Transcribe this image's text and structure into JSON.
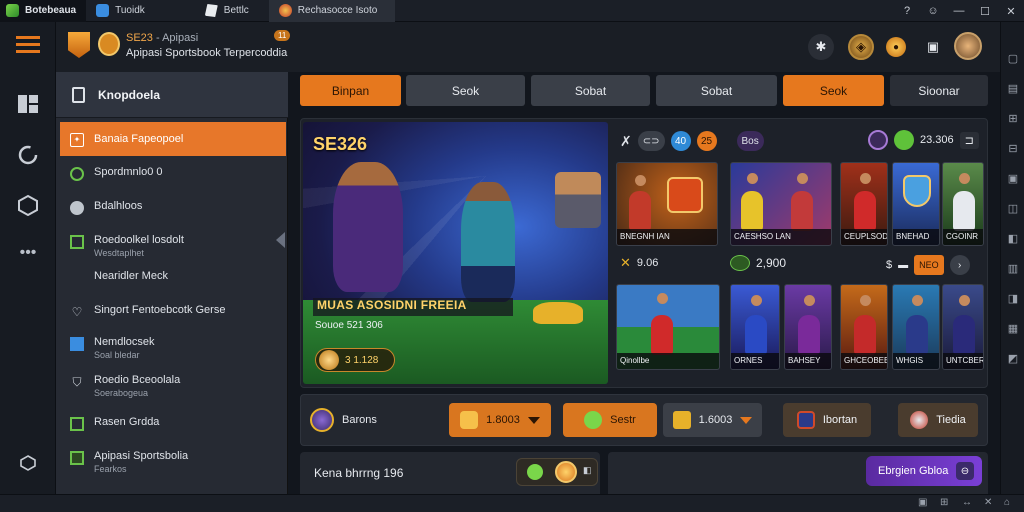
{
  "titlebar": {
    "app_name": "Botebeaua",
    "tabs": [
      {
        "label": "Tuoidk",
        "icon": "window-icon"
      },
      {
        "label": "Bettlc",
        "icon": "bag-icon"
      },
      {
        "label": "Rechasocce Isoto",
        "icon": "globe-icon"
      }
    ],
    "controls": [
      "help-icon",
      "smile-icon",
      "minimize-icon",
      "maximize-icon",
      "close-icon"
    ]
  },
  "header": {
    "brand_name": "SE23",
    "brand_sep": " - Apipasi",
    "brand_line2": "Apipasi Sportsbook Terpercoddia",
    "badge": "11"
  },
  "sidebar": {
    "title": "Knopdoela",
    "items": [
      {
        "label": "Banaia Fapeopoel",
        "sub": "",
        "icon": "gift-icon",
        "active": true
      },
      {
        "label": "Spordmnlo0 0",
        "sub": "",
        "icon": "circle-icon"
      },
      {
        "label": "Bdalhloos",
        "sub": "",
        "icon": "ball-icon"
      },
      {
        "label": "Roedoolkel losdolt",
        "sub": "Wesdtaplhet",
        "icon": "grid-icon"
      },
      {
        "label": "Nearidler Meck",
        "sub": "",
        "icon": ""
      },
      {
        "label": "Singort Fentoebcotk Gerse",
        "sub": "",
        "icon": "heart-icon"
      },
      {
        "label": "Nemdlocsek",
        "sub": "Soal bledar",
        "icon": "square-icon"
      },
      {
        "label": "Roedio Bceoolala",
        "sub": "Soerabogeua",
        "icon": "shield-icon"
      },
      {
        "label": "Rasen Grdda",
        "sub": "",
        "icon": "square-outline-icon"
      },
      {
        "label": "Apipasi Sportsbolia",
        "sub": "Fearkos",
        "icon": "box-icon"
      }
    ]
  },
  "tabs": [
    {
      "label": "Binpan",
      "style": "orange"
    },
    {
      "label": "Seok",
      "style": "grey"
    },
    {
      "label": "Sobat",
      "style": "grey"
    },
    {
      "label": "Sobat",
      "style": "grey"
    },
    {
      "label": "Seok",
      "style": "orange"
    },
    {
      "label": "Sioonar",
      "style": "pale"
    }
  ],
  "hero": {
    "title": "SE326",
    "banner": "MUAS ASOSIDNI FREEIA",
    "subline": "Souoe 521 306",
    "coin_value": "3 1.128"
  },
  "market_header": {
    "pill_1": "40",
    "pill_2": "25",
    "label": "Bos",
    "score": "23.306"
  },
  "cards_row1": [
    {
      "caption": "BNEGNH IAN",
      "bg": "#4a2a16"
    },
    {
      "caption": "CAESHSO LAN",
      "bg": "#1c2a6a"
    },
    {
      "caption": "CEUPLSOD",
      "bg": "#5a1a10"
    },
    {
      "caption": "BNEHAD",
      "bg": "#1a3a6a"
    },
    {
      "caption": "CGOINR",
      "bg": "#2a4a2a"
    }
  ],
  "meta": {
    "left_value": "9.06",
    "mid_value": "2,900",
    "right_badge": "NEO"
  },
  "cards_row2": [
    {
      "caption": "Qinollbe",
      "bg": "#1b4a2c"
    },
    {
      "caption": "ORNES",
      "bg": "#1b2b6a"
    },
    {
      "caption": "BAHSEY",
      "bg": "#3a1b5a"
    },
    {
      "caption": "GHCEOBEE",
      "bg": "#6a2a10"
    },
    {
      "caption": "WHGIS",
      "bg": "#1a4a5a"
    },
    {
      "caption": "UNTCBER",
      "bg": "#2a2a5a"
    }
  ],
  "bottom_bar": {
    "left_label": "Barons",
    "btn_1": "1.8003",
    "btn_2": "Sestr",
    "btn_3": "1.6003",
    "btn_4": "Ibortan",
    "btn_5": "Tiedia"
  },
  "footer": {
    "kena": "Kena bhrrng 196",
    "register": "Ebrgien Gbloa"
  },
  "colors": {
    "accent": "#e6781e",
    "bg": "#12161d",
    "panel": "#23272f",
    "purple": "#6a34c2"
  }
}
